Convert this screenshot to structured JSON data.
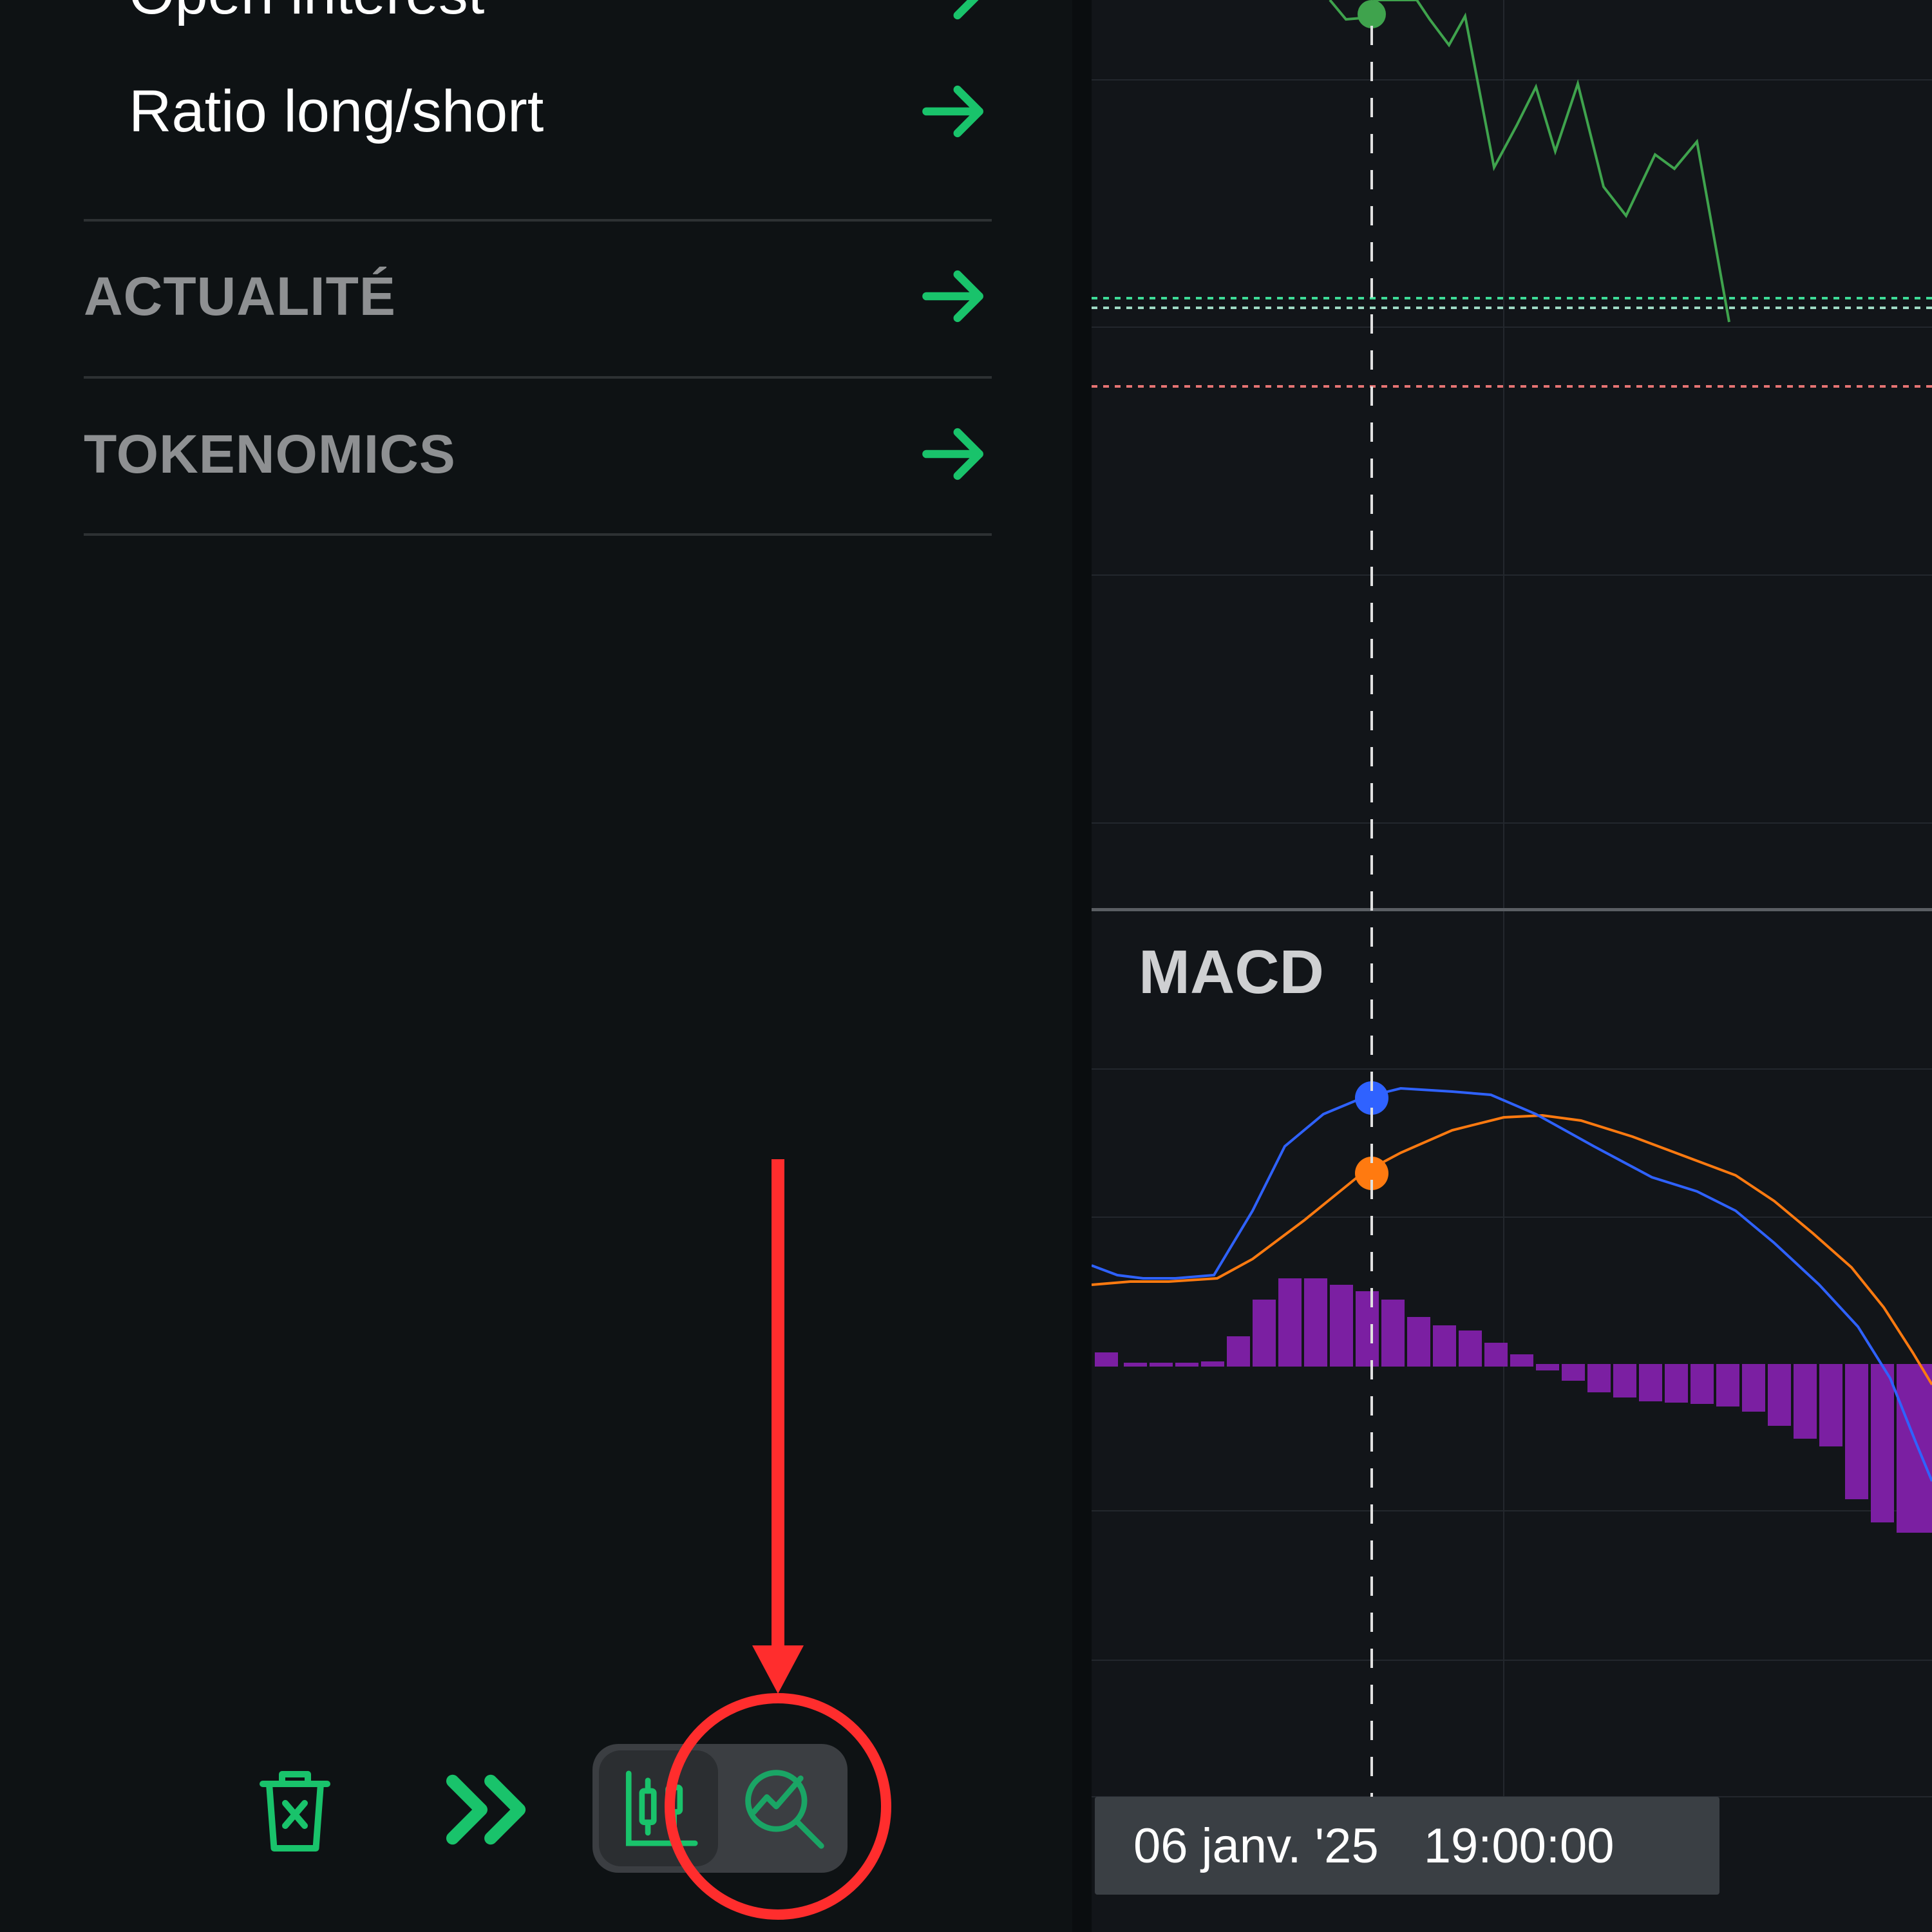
{
  "sidebar": {
    "sub_items": [
      {
        "label": "Open interest"
      },
      {
        "label": "Ratio long/short"
      }
    ],
    "sections": [
      {
        "label": "ACTUALITÉ"
      },
      {
        "label": "TOKENOMICS"
      }
    ]
  },
  "toolbar": {
    "icons": [
      "trash-x-icon",
      "double-chevron-right-icon",
      "candlestick-chart-icon",
      "chart-search-icon"
    ]
  },
  "chart": {
    "macd_label": "MACD",
    "crosshair": {
      "date": "06 janv. '25",
      "time": "19:00:00"
    },
    "colors": {
      "price_line": "#3fa34d",
      "macd_line": "#2f62ff",
      "signal_line": "#ff7a10",
      "histogram": "#7b1fa2",
      "dotted_green": "#3ddc97",
      "dotted_red": "#e57373",
      "annotation": "#ff2d2d",
      "accent": "#19c36b"
    }
  }
}
